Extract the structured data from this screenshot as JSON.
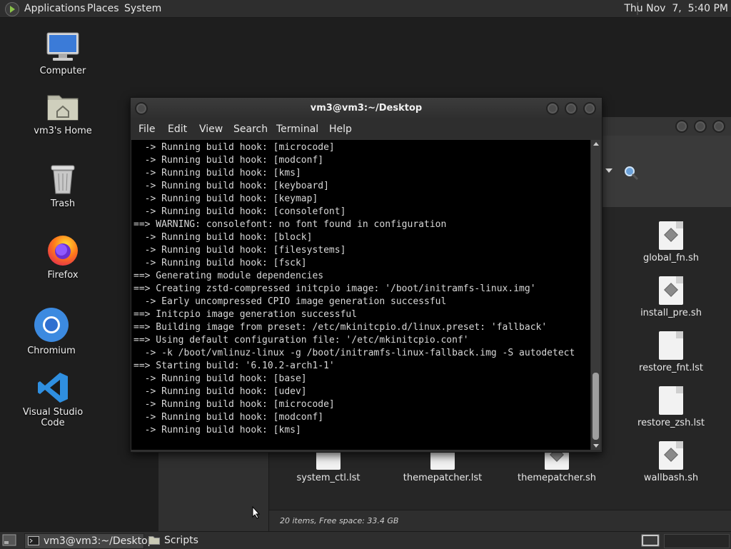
{
  "top_panel": {
    "menus": [
      "Applications",
      "Places",
      "System"
    ],
    "clock": "Thu Nov  7,  5:40 PM"
  },
  "desktop": {
    "icons": [
      {
        "label": "Computer"
      },
      {
        "label": "vm3's Home"
      },
      {
        "label": "Trash"
      },
      {
        "label": "Firefox"
      },
      {
        "label": "Chromium"
      },
      {
        "label": "Visual Studio Code"
      }
    ]
  },
  "terminal": {
    "title": "vm3@vm3:~/Desktop",
    "menu": [
      "File",
      "Edit",
      "View",
      "Search",
      "Terminal",
      "Help"
    ],
    "lines": [
      "  -> Running build hook: [microcode]",
      "  -> Running build hook: [modconf]",
      "  -> Running build hook: [kms]",
      "  -> Running build hook: [keyboard]",
      "  -> Running build hook: [keymap]",
      "  -> Running build hook: [consolefont]",
      "==> WARNING: consolefont: no font found in configuration",
      "  -> Running build hook: [block]",
      "  -> Running build hook: [filesystems]",
      "  -> Running build hook: [fsck]",
      "==> Generating module dependencies",
      "==> Creating zstd-compressed initcpio image: '/boot/initramfs-linux.img'",
      "  -> Early uncompressed CPIO image generation successful",
      "==> Initcpio image generation successful",
      "==> Building image from preset: /etc/mkinitcpio.d/linux.preset: 'fallback'",
      "==> Using default configuration file: '/etc/mkinitcpio.conf'",
      "  -> -k /boot/vmlinuz-linux -g /boot/initramfs-linux-fallback.img -S autodetect",
      "==> Starting build: '6.10.2-arch1-1'",
      "  -> Running build hook: [base]",
      "  -> Running build hook: [udev]",
      "  -> Running build hook: [microcode]",
      "  -> Running build hook: [modconf]",
      "  -> Running build hook: [kms]"
    ]
  },
  "file_manager": {
    "files_right": [
      "global_fn.sh",
      "install_pre.sh",
      "restore_fnt.lst",
      "restore_zsh.lst",
      "wallbash.sh"
    ],
    "files_bottom": [
      "system_ctl.lst",
      "themepatcher.lst",
      "themepatcher.sh"
    ],
    "status": "20 items, Free space: 33.4 GB"
  },
  "bottom_panel": {
    "tasks": [
      "vm3@vm3:~/Desktop",
      "Scripts"
    ]
  }
}
